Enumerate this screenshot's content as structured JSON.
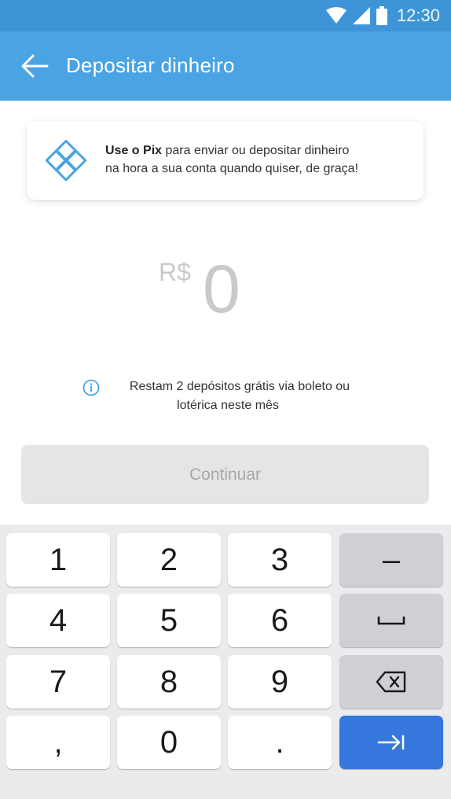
{
  "status_bar": {
    "time": "12:30"
  },
  "app_bar": {
    "title": "Depositar dinheiro"
  },
  "pix_card": {
    "bold": "Use o Pix",
    "text_rest": " para enviar ou depositar dinheiro",
    "line2": "na hora a sua conta quando quiser, de graça!"
  },
  "amount": {
    "currency": "R$",
    "value": "0"
  },
  "notice": {
    "line1": "Restam 2 depósitos grátis via boleto ou",
    "line2": "lotérica neste mês"
  },
  "continue_button": {
    "label": "Continuar"
  },
  "keyboard": {
    "k1": "1",
    "k2": "2",
    "k3": "3",
    "minus": "–",
    "k4": "4",
    "k5": "5",
    "k6": "6",
    "k7": "7",
    "k8": "8",
    "k9": "9",
    "comma": ",",
    "k0": "0",
    "period": "."
  }
}
